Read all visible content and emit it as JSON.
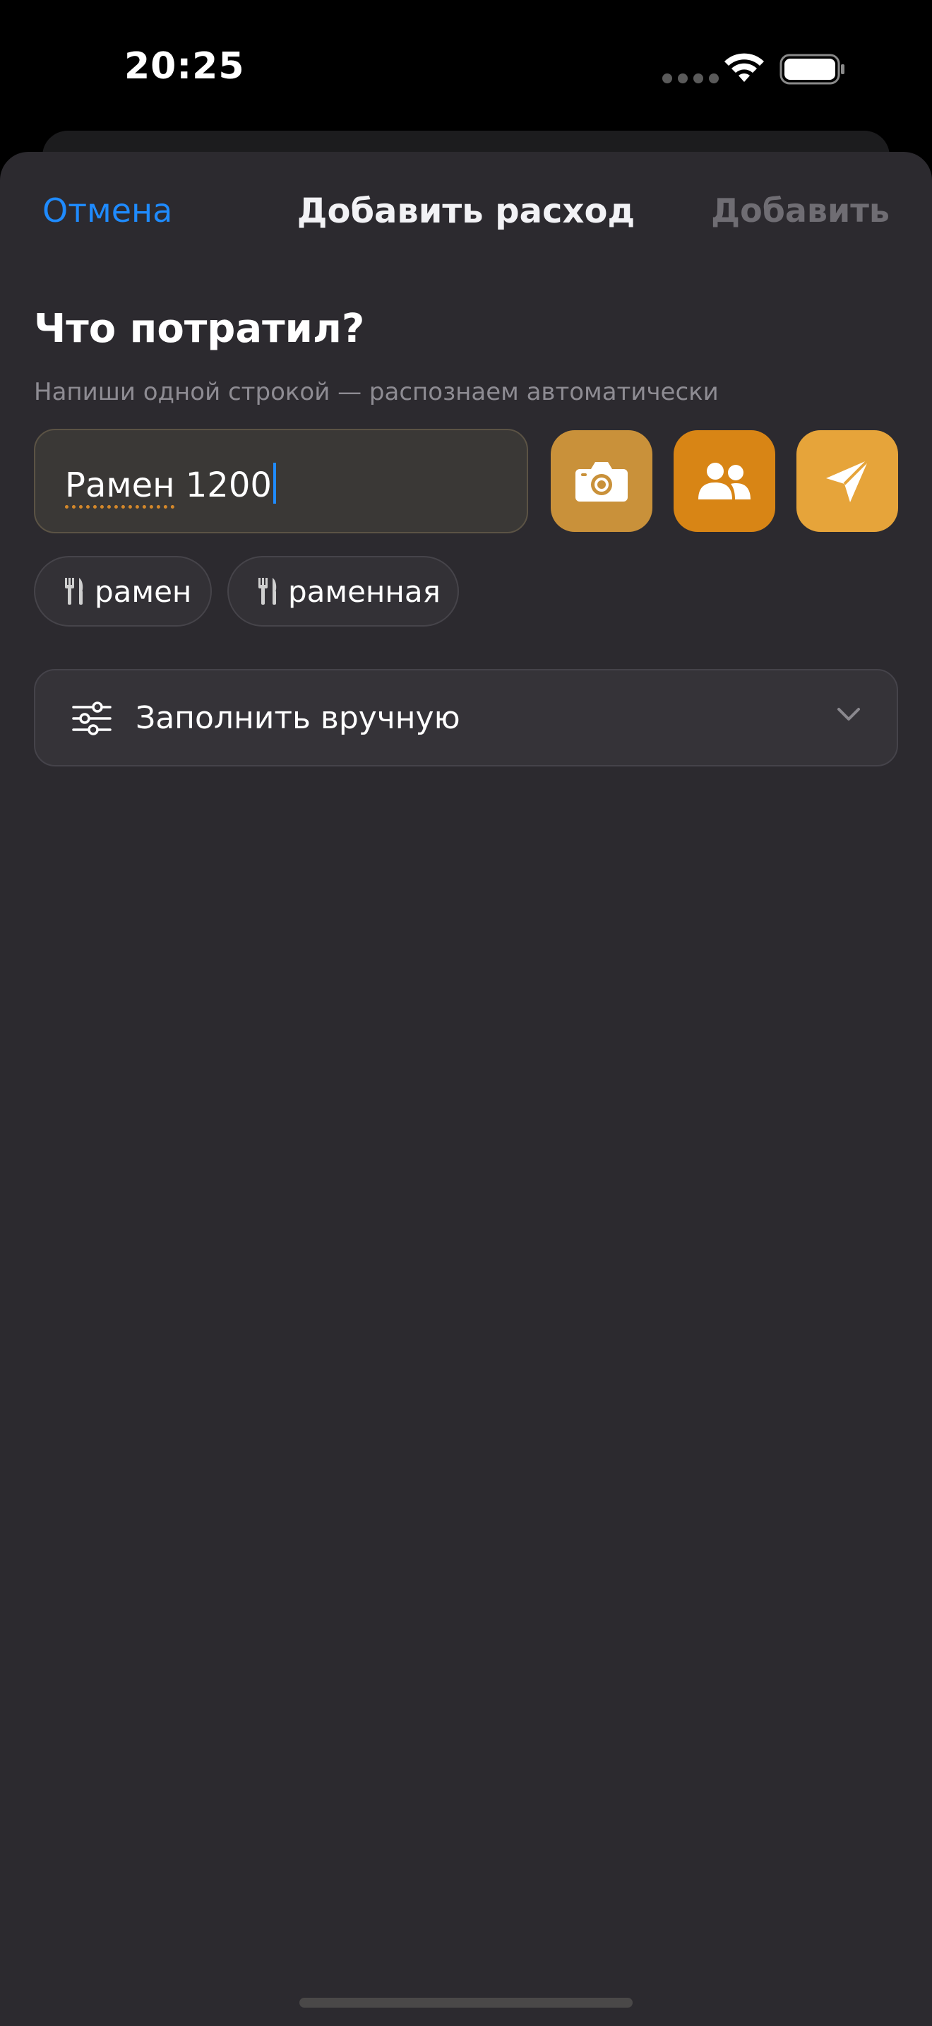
{
  "status_bar": {
    "time": "20:25",
    "icons": [
      "signal-dots-icon",
      "wifi-icon",
      "battery-icon"
    ]
  },
  "nav": {
    "cancel_label": "Отмена",
    "title": "Добавить расход",
    "add_label": "Добавить"
  },
  "form": {
    "heading": "Что потратил?",
    "subheading": "Напиши одной строкой — распознаем автоматически",
    "input_word": "Рамен",
    "input_rest": " 1200",
    "input_value": "Рамен 1200"
  },
  "actions": [
    {
      "icon": "camera-icon"
    },
    {
      "icon": "people-icon"
    },
    {
      "icon": "send-icon"
    }
  ],
  "suggestions": [
    {
      "icon": "fork-knife-icon",
      "label": "рамен"
    },
    {
      "icon": "fork-knife-icon",
      "label": "раменная"
    }
  ],
  "manual": {
    "label": "Заполнить вручную",
    "icon": "sliders-icon",
    "expand_icon": "chevron-down-icon"
  },
  "colors": {
    "accent_blue": "#1f8bff",
    "camera_button": "#c9913a",
    "people_button": "#d88515",
    "send_button": "#e6a43a",
    "sheet_background": "#2c2a2f"
  }
}
